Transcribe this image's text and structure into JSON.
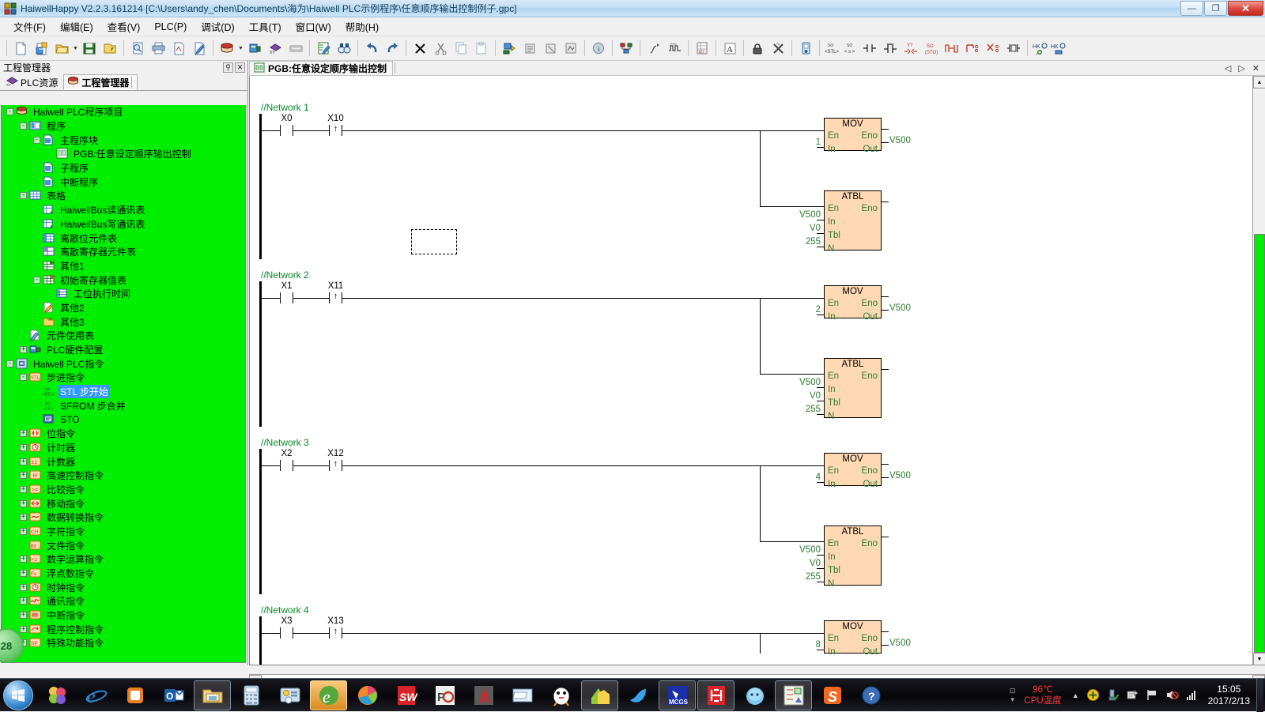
{
  "window": {
    "title": "HaiwellHappy V2.2.3.161214 [C:\\Users\\andy_chen\\Documents\\海为\\Haiwell PLC示例程序\\任意顺序输出控制例子.gpc]",
    "app_icon": "plc-app-icon",
    "minimize_label": "—",
    "restore_label": "❐",
    "close_label": "✕"
  },
  "menu": [
    {
      "label": "文件(F)",
      "name": "menu-file"
    },
    {
      "label": "编辑(E)",
      "name": "menu-edit"
    },
    {
      "label": "查看(V)",
      "name": "menu-view"
    },
    {
      "label": "PLC(P)",
      "name": "menu-plc"
    },
    {
      "label": "调试(D)",
      "name": "menu-debug"
    },
    {
      "label": "工具(T)",
      "name": "menu-tools"
    },
    {
      "label": "窗口(W)",
      "name": "menu-window"
    },
    {
      "label": "帮助(H)",
      "name": "menu-help"
    }
  ],
  "toolbar": {
    "groups": [
      [
        "new-file-icon",
        "new-project-icon",
        "open-folder-icon",
        "dropdown-caret",
        "save-icon",
        "save-as-icon"
      ],
      [
        "print-preview-icon",
        "print-icon",
        "export-icon",
        "edit-doc-icon"
      ],
      [
        "project-stack-icon",
        "dropdown-caret",
        "plc-config-icon",
        "plc-resource-icon",
        "monitor-strip-icon"
      ],
      [
        "edit-table-icon",
        "find-binoculars-icon"
      ],
      [
        "undo-icon",
        "redo-icon"
      ],
      [
        "delete-x-icon",
        "cut-icon",
        "copy-icon",
        "paste-icon"
      ],
      [
        "download-plc-icon",
        "upload-plc-icon",
        "compare-icon",
        "compile-icon"
      ],
      [
        "info-icon"
      ],
      [
        "network-config-icon"
      ],
      [
        "debug-run-icon",
        "waveform-icon"
      ],
      [
        "register-table-icon"
      ],
      [
        "font-icon"
      ],
      [
        "lock-icon",
        "clear-icon"
      ],
      [
        "device-info-icon"
      ],
      [
        "stl-instruction-icon",
        "s-instruction-icon",
        "contact-no-icon",
        "contact-nc-icon",
        "coil-y-icon",
        "sto-icon",
        "rising-edge-icon",
        "branch-down-icon",
        "branch-del-icon",
        "box-instruction-icon"
      ],
      [
        "hkey-add-icon",
        "hkey-edit-icon"
      ]
    ]
  },
  "dock": {
    "title": "工程管理器",
    "pin_label": "⚲",
    "close_label": "✕",
    "tabs": [
      {
        "label": "PLC资源",
        "icon": "plc-resource-icon",
        "active": false
      },
      {
        "label": "工程管理器",
        "icon": "project-manager-icon",
        "active": true
      }
    ],
    "tree": [
      {
        "depth": 0,
        "expander": "-",
        "icon": "project-root-icon",
        "label": "Haiwell PLC程序项目",
        "selected": false
      },
      {
        "depth": 1,
        "expander": "-",
        "icon": "program-folder-icon",
        "label": "程序",
        "selected": false
      },
      {
        "depth": 2,
        "expander": "-",
        "icon": "block-icon",
        "label": "主程序块",
        "selected": false
      },
      {
        "depth": 3,
        "expander": "",
        "icon": "pgb-icon",
        "label": "PGB:任意设定顺序输出控制",
        "selected": false
      },
      {
        "depth": 2,
        "expander": "",
        "icon": "block-icon",
        "label": "子程序",
        "selected": false
      },
      {
        "depth": 2,
        "expander": "",
        "icon": "block-icon",
        "label": "中断程序",
        "selected": false
      },
      {
        "depth": 1,
        "expander": "-",
        "icon": "table-icon",
        "label": "表格",
        "selected": false
      },
      {
        "depth": 2,
        "expander": "",
        "icon": "bus-table-icon",
        "label": "HaiwellBus读通讯表",
        "selected": false
      },
      {
        "depth": 2,
        "expander": "",
        "icon": "bus-table-icon",
        "label": "HaiwellBus写通讯表",
        "selected": false
      },
      {
        "depth": 2,
        "expander": "",
        "icon": "bit-table-icon",
        "label": "离散位元件表",
        "selected": false
      },
      {
        "depth": 2,
        "expander": "",
        "icon": "reg-table-icon",
        "label": "离散寄存器元件表",
        "selected": false
      },
      {
        "depth": 2,
        "expander": "",
        "icon": "other-table-icon",
        "label": "其他1",
        "selected": false
      },
      {
        "depth": 2,
        "expander": "-",
        "icon": "init-reg-table-icon",
        "label": "初始寄存器值表",
        "selected": false
      },
      {
        "depth": 3,
        "expander": "",
        "icon": "sub-table-icon",
        "label": "工位执行时间",
        "selected": false
      },
      {
        "depth": 2,
        "expander": "",
        "icon": "other2-icon",
        "label": "其他2",
        "selected": false
      },
      {
        "depth": 2,
        "expander": "",
        "icon": "other3-icon",
        "label": "其他3",
        "selected": false
      },
      {
        "depth": 1,
        "expander": "",
        "icon": "usage-table-icon",
        "label": "元件使用表",
        "selected": false
      },
      {
        "depth": 1,
        "expander": "+",
        "icon": "hardware-config-icon",
        "label": "PLC硬件配置",
        "selected": false
      },
      {
        "depth": 0,
        "expander": "-",
        "icon": "instruction-root-icon",
        "label": "Haiwell PLC指令",
        "selected": false
      },
      {
        "depth": 1,
        "expander": "-",
        "icon": "stl-folder-icon",
        "label": "步进指令",
        "selected": false
      },
      {
        "depth": 2,
        "expander": "",
        "icon": "stl-icon",
        "label": "STL 步开始",
        "selected": true
      },
      {
        "depth": 2,
        "expander": "",
        "icon": "sfrom-icon",
        "label": "SFROM 步合并",
        "selected": false
      },
      {
        "depth": 2,
        "expander": "",
        "icon": "sto-icon",
        "label": "STO",
        "selected": false
      },
      {
        "depth": 1,
        "expander": "+",
        "icon": "bit-instr-icon",
        "label": "位指令",
        "selected": false
      },
      {
        "depth": 1,
        "expander": "+",
        "icon": "timer-icon",
        "label": "计时器",
        "selected": false
      },
      {
        "depth": 1,
        "expander": "+",
        "icon": "counter-icon",
        "label": "计数器",
        "selected": false
      },
      {
        "depth": 1,
        "expander": "+",
        "icon": "highspeed-icon",
        "label": "高速控制指令",
        "selected": false
      },
      {
        "depth": 1,
        "expander": "+",
        "icon": "compare-instr-icon",
        "label": "比较指令",
        "selected": false
      },
      {
        "depth": 1,
        "expander": "+",
        "icon": "move-instr-icon",
        "label": "移动指令",
        "selected": false
      },
      {
        "depth": 1,
        "expander": "+",
        "icon": "convert-instr-icon",
        "label": "数据转换指令",
        "selected": false
      },
      {
        "depth": 1,
        "expander": "+",
        "icon": "char-instr-icon",
        "label": "字符指令",
        "selected": false
      },
      {
        "depth": 1,
        "expander": "",
        "icon": "file-instr-icon",
        "label": "文件指令",
        "selected": false
      },
      {
        "depth": 1,
        "expander": "+",
        "icon": "math-instr-icon",
        "label": "数学运算指令",
        "selected": false
      },
      {
        "depth": 1,
        "expander": "+",
        "icon": "float-instr-icon",
        "label": "浮点数指令",
        "selected": false
      },
      {
        "depth": 1,
        "expander": "+",
        "icon": "clock-instr-icon",
        "label": "时钟指令",
        "selected": false
      },
      {
        "depth": 1,
        "expander": "+",
        "icon": "comm-instr-icon",
        "label": "通讯指令",
        "selected": false
      },
      {
        "depth": 1,
        "expander": "+",
        "icon": "interrupt-instr-icon",
        "label": "中断指令",
        "selected": false
      },
      {
        "depth": 1,
        "expander": "+",
        "icon": "progctrl-instr-icon",
        "label": "程序控制指令",
        "selected": false
      },
      {
        "depth": 1,
        "expander": "+",
        "icon": "special-instr-icon",
        "label": "特殊功能指令",
        "selected": false
      }
    ]
  },
  "editor": {
    "tab": {
      "label": "PGB:任意设定顺序输出控制",
      "icon": "pgb-icon"
    },
    "tab_controls": {
      "prev": "◁",
      "next": "▷",
      "close": "✕"
    },
    "networks": [
      {
        "label": "//Network 1",
        "contacts": [
          {
            "name": "X0",
            "type": "no"
          },
          {
            "name": "X10",
            "type": "rising"
          }
        ],
        "blocks": [
          {
            "name": "MOV",
            "inputs": [
              {
                "pin": "En",
                "value": ""
              },
              {
                "pin": "In",
                "value": "1"
              }
            ],
            "outputs": [
              {
                "pin": "Eno",
                "value": ""
              },
              {
                "pin": "Out",
                "value": "V500"
              }
            ]
          },
          {
            "name": "ATBL",
            "inputs": [
              {
                "pin": "En",
                "value": ""
              },
              {
                "pin": "In",
                "value": "V500"
              },
              {
                "pin": "Tbl",
                "value": "V0"
              },
              {
                "pin": "N",
                "value": "255"
              }
            ],
            "outputs": [
              {
                "pin": "Eno",
                "value": ""
              }
            ]
          }
        ]
      },
      {
        "label": "//Network 2",
        "contacts": [
          {
            "name": "X1",
            "type": "no"
          },
          {
            "name": "X11",
            "type": "rising"
          }
        ],
        "blocks": [
          {
            "name": "MOV",
            "inputs": [
              {
                "pin": "En",
                "value": ""
              },
              {
                "pin": "In",
                "value": "2"
              }
            ],
            "outputs": [
              {
                "pin": "Eno",
                "value": ""
              },
              {
                "pin": "Out",
                "value": "V500"
              }
            ]
          },
          {
            "name": "ATBL",
            "inputs": [
              {
                "pin": "En",
                "value": ""
              },
              {
                "pin": "In",
                "value": "V500"
              },
              {
                "pin": "Tbl",
                "value": "V0"
              },
              {
                "pin": "N",
                "value": "255"
              }
            ],
            "outputs": [
              {
                "pin": "Eno",
                "value": ""
              }
            ]
          }
        ]
      },
      {
        "label": "//Network 3",
        "contacts": [
          {
            "name": "X2",
            "type": "no"
          },
          {
            "name": "X12",
            "type": "rising"
          }
        ],
        "blocks": [
          {
            "name": "MOV",
            "inputs": [
              {
                "pin": "En",
                "value": ""
              },
              {
                "pin": "In",
                "value": "4"
              }
            ],
            "outputs": [
              {
                "pin": "Eno",
                "value": ""
              },
              {
                "pin": "Out",
                "value": "V500"
              }
            ]
          },
          {
            "name": "ATBL",
            "inputs": [
              {
                "pin": "En",
                "value": ""
              },
              {
                "pin": "In",
                "value": "V500"
              },
              {
                "pin": "Tbl",
                "value": "V0"
              },
              {
                "pin": "N",
                "value": "255"
              }
            ],
            "outputs": [
              {
                "pin": "Eno",
                "value": ""
              }
            ]
          }
        ]
      },
      {
        "label": "//Network 4",
        "contacts": [
          {
            "name": "X3",
            "type": "no"
          },
          {
            "name": "X13",
            "type": "rising"
          }
        ],
        "blocks": [
          {
            "name": "MOV",
            "inputs": [
              {
                "pin": "En",
                "value": ""
              },
              {
                "pin": "In",
                "value": "8"
              }
            ],
            "outputs": [
              {
                "pin": "Eno",
                "value": ""
              },
              {
                "pin": "Out",
                "value": "V500"
              }
            ]
          }
        ]
      }
    ]
  },
  "gadget": {
    "value": "28"
  },
  "taskbar": {
    "start_label": "⊞",
    "items": [
      {
        "name": "taskbar-item-photos",
        "state": "normal"
      },
      {
        "name": "taskbar-item-internet-explorer",
        "state": "normal"
      },
      {
        "name": "taskbar-item-office",
        "state": "normal"
      },
      {
        "name": "taskbar-item-outlook",
        "state": "normal"
      },
      {
        "name": "taskbar-item-explorer",
        "state": "active"
      },
      {
        "name": "taskbar-item-calculator",
        "state": "normal"
      },
      {
        "name": "taskbar-item-control-panel",
        "state": "normal"
      },
      {
        "name": "taskbar-item-browser",
        "state": "hot"
      },
      {
        "name": "taskbar-item-media",
        "state": "normal"
      },
      {
        "name": "taskbar-item-solidworks",
        "state": "normal"
      },
      {
        "name": "taskbar-item-proe",
        "state": "normal"
      },
      {
        "name": "taskbar-item-autocad",
        "state": "normal"
      },
      {
        "name": "taskbar-item-window",
        "state": "normal"
      },
      {
        "name": "taskbar-item-qq",
        "state": "normal"
      },
      {
        "name": "taskbar-item-notes",
        "state": "active"
      },
      {
        "name": "taskbar-item-bird",
        "state": "normal"
      },
      {
        "name": "taskbar-item-mcgs",
        "state": "active"
      },
      {
        "name": "taskbar-item-haiwell",
        "state": "active"
      },
      {
        "name": "taskbar-item-water",
        "state": "normal"
      },
      {
        "name": "taskbar-item-plc-editor",
        "state": "active"
      },
      {
        "name": "taskbar-item-sogou",
        "state": "normal"
      },
      {
        "name": "taskbar-item-help",
        "state": "normal"
      }
    ],
    "tray": {
      "cpu_temp": "96℃",
      "cpu_label": "CPU温度",
      "expand_arrow": "▲",
      "icons": [
        "shield-update-icon",
        "usb-safe-remove-icon",
        "network-share-icon",
        "flag-action-center-icon",
        "volume-muted-icon",
        "signal-bars-icon"
      ],
      "time": "15:05",
      "date": "2017/2/13",
      "ime_top": "⊡",
      "ime_bottom": "▾"
    }
  }
}
